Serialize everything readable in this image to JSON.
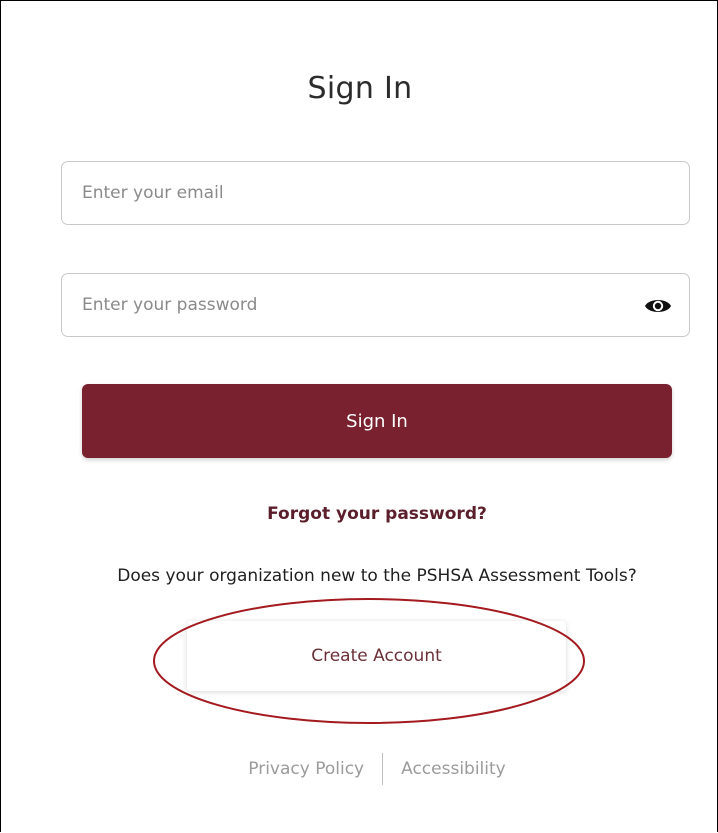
{
  "title": "Sign In",
  "email": {
    "placeholder": "Enter your email",
    "value": ""
  },
  "password": {
    "placeholder": "Enter your password",
    "value": "",
    "toggle_icon": "eye-icon"
  },
  "sign_in_button": "Sign In",
  "forgot_password": "Forgot your password?",
  "new_org_question": "Does your organization new to the PSHSA Assessment Tools?",
  "create_account_button": "Create Account",
  "footer": {
    "privacy": "Privacy Policy",
    "accessibility": "Accessibility"
  },
  "colors": {
    "primary": "#7a2130",
    "link": "#5b1f2c",
    "annotation": "#a31a1f"
  }
}
